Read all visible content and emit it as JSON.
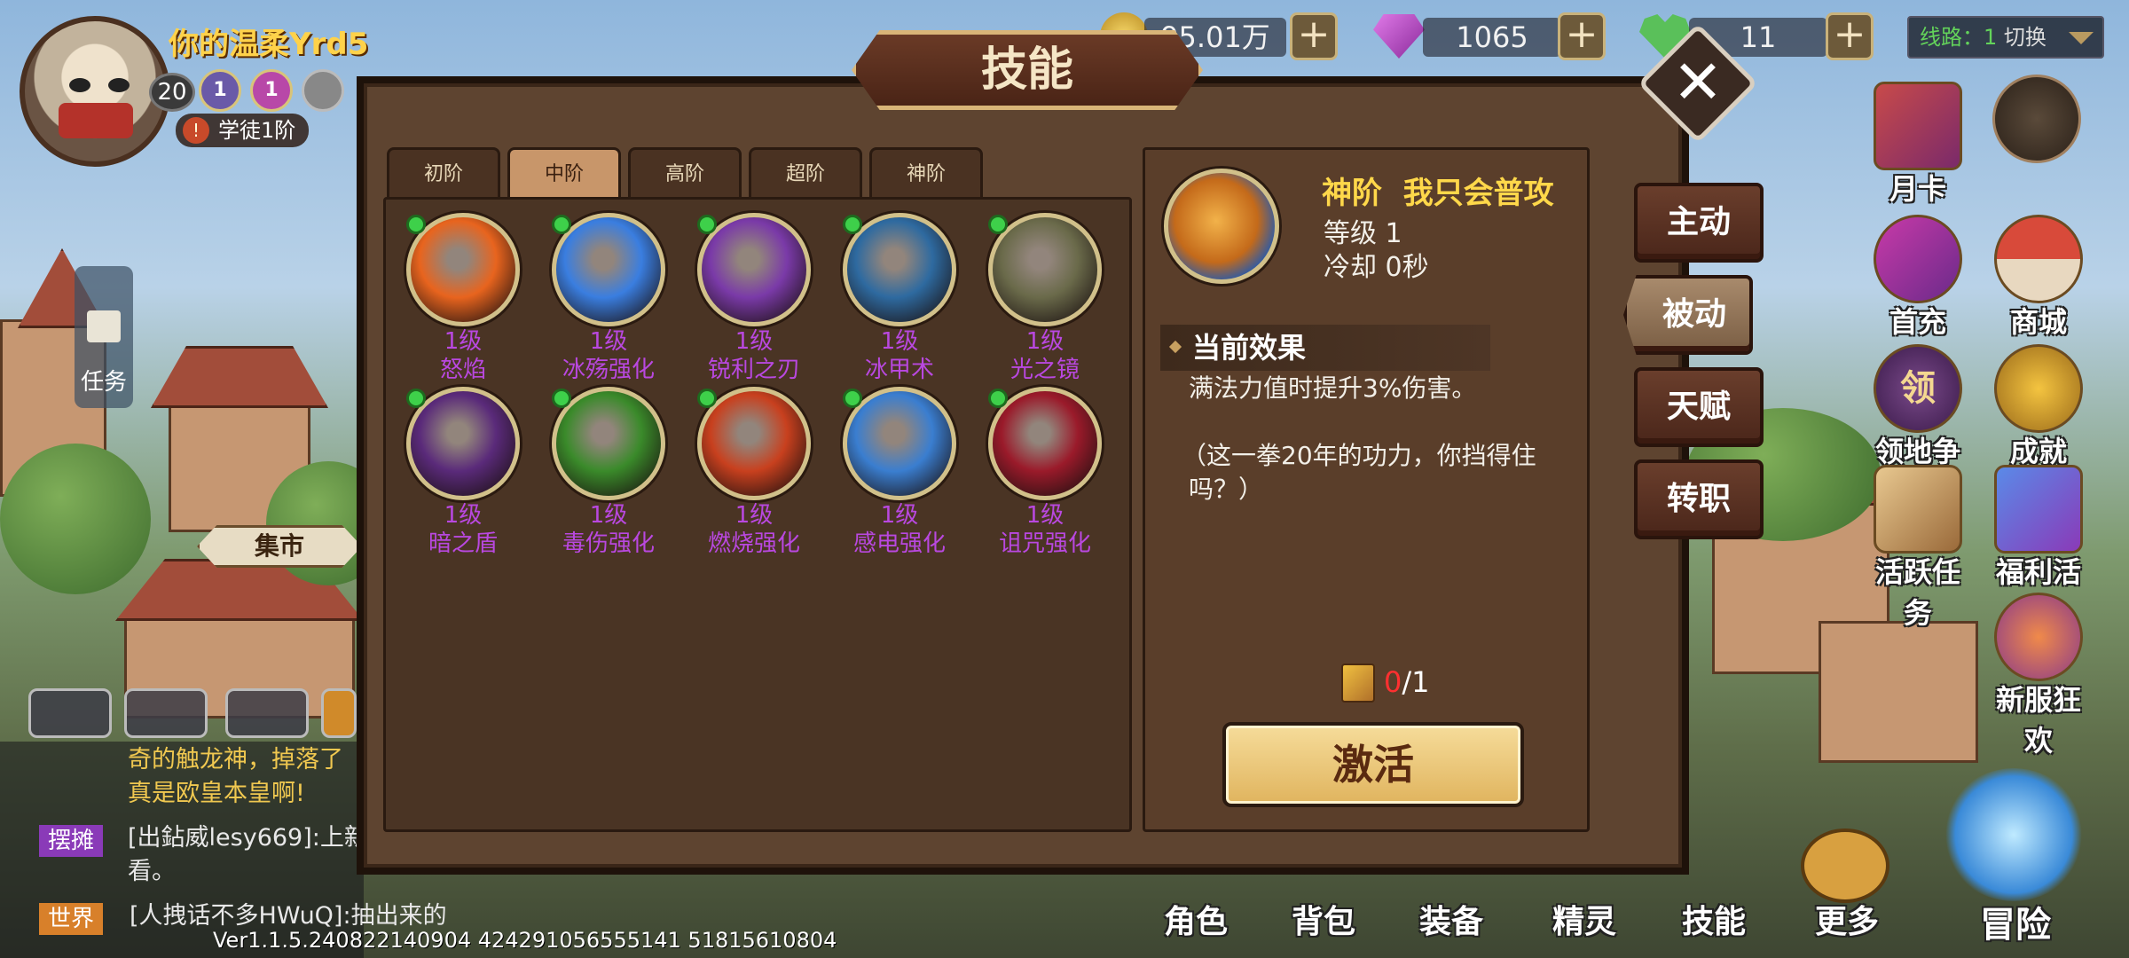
{
  "player": {
    "name": "你的温柔Yrd5",
    "level": "20",
    "rank_badges": [
      "1",
      "1"
    ],
    "title": "学徒1阶"
  },
  "resources": {
    "gold": "95.01万",
    "gems": "1065",
    "hearts": "11"
  },
  "route": {
    "label": "线路：1",
    "switch": "切换"
  },
  "right_icons": [
    "月卡",
    "首充",
    "商城",
    "领地争夺",
    "成就",
    "活跃任务",
    "福利活动",
    "新服狂欢"
  ],
  "territory_glyph": "领",
  "bottom_nav": [
    "角色",
    "背包",
    "装备",
    "精灵",
    "技能",
    "更多",
    "冒险"
  ],
  "left": {
    "task": "任务",
    "market": "集市"
  },
  "chat": {
    "line1": "奇的触龙神，掉落了",
    "line2": "真是欧皇本皇啊!",
    "tag_stall": "摆摊",
    "line3": "[出鉆威lesy669]:上新",
    "line4": "看。",
    "tag_world": "世界",
    "line5": "[人拽话不多HWuQ]:抽出来的"
  },
  "version": "Ver1.1.5.240822140904   424291056555141   51815610804",
  "modal": {
    "title": "技能",
    "tabs": [
      "初阶",
      "中阶",
      "高阶",
      "超阶",
      "神阶"
    ],
    "active_tab": "中阶",
    "skills": [
      {
        "level": "1级",
        "name": "怒焰",
        "color": "#e8641e"
      },
      {
        "level": "1级",
        "name": "冰殇强化",
        "color": "#3a7ee0"
      },
      {
        "level": "1级",
        "name": "锐利之刃",
        "color": "#7a3aa8"
      },
      {
        "level": "1级",
        "name": "冰甲术",
        "color": "#2e6aa0"
      },
      {
        "level": "1级",
        "name": "光之镜",
        "color": "#6a6a4a"
      },
      {
        "level": "1级",
        "name": "暗之盾",
        "color": "#5a2a7a"
      },
      {
        "level": "1级",
        "name": "毒伤强化",
        "color": "#3a8a2a"
      },
      {
        "level": "1级",
        "name": "燃烧强化",
        "color": "#c8401e"
      },
      {
        "level": "1级",
        "name": "感电强化",
        "color": "#3a7ed0"
      },
      {
        "level": "1级",
        "name": "诅咒强化",
        "color": "#9a1a2a"
      }
    ],
    "detail": {
      "tier": "神阶",
      "name": "我只会普攻",
      "level": "等级 1",
      "cooldown": "冷却 0秒",
      "effect_header": "当前效果",
      "effect_text": "满法力值时提升3%伤害。",
      "flavor_line1": "（这一拳20年的功力，你挡得住",
      "flavor_line2": "吗？）",
      "count_have": "0",
      "count_need": "/1",
      "activate": "激活"
    },
    "side_tabs": [
      "主动",
      "被动",
      "天赋",
      "转职"
    ],
    "active_side_tab": "被动"
  }
}
